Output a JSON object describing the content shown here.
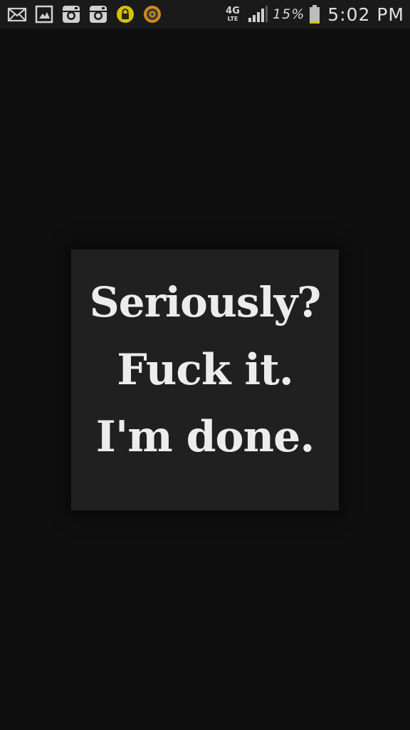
{
  "status_bar": {
    "notification_icons": [
      "mail-icon",
      "gallery-icon",
      "instagram-icon",
      "instagram-icon",
      "lock-icon",
      "target-app-icon"
    ],
    "network": "4G",
    "network_sub": "LTE",
    "battery_percent": "15%",
    "battery_level": 0.15,
    "time": "5:02 PM"
  },
  "quote": {
    "line1": "Seriously?",
    "line2": "Fuck it.",
    "line3": "I'm done."
  },
  "colors": {
    "background": "#0f0f0f",
    "card": "#202020",
    "text": "#ececec",
    "lock_badge": "#d4c20a",
    "target_badge": "#d08a1a"
  }
}
